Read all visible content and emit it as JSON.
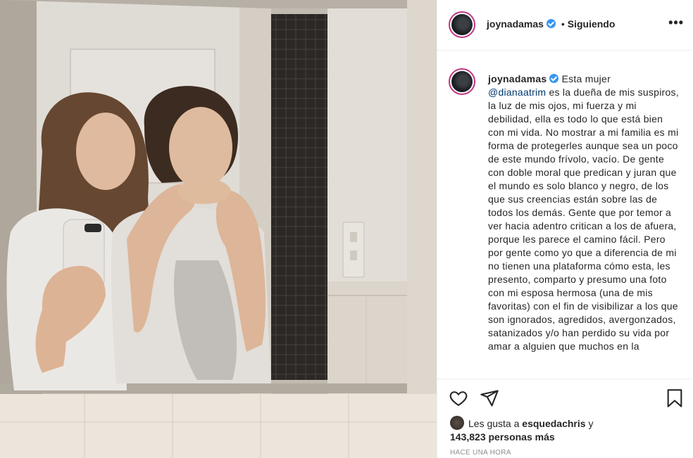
{
  "post": {
    "username": "joynadamas",
    "follow_status": "Siguiendo",
    "separator": "•",
    "more_label": "•••",
    "caption": {
      "username": "joynadamas",
      "intro": "Esta mujer",
      "mention": "@dianaatrim",
      "text": "es la dueña de mis suspiros, la luz de mis ojos, mi fuerza y mi debilidad, ella es todo lo que está bien con mi vida. No mostrar a mi familia es mi forma de protegerles aunque sea un poco de este mundo frívolo, vacío. De gente con doble moral que predican y juran que el mundo es solo blanco y negro, de los que sus creencias están sobre las de todos los demás. Gente que por temor a ver hacia adentro critican a los de afuera, porque les parece el camino fácil. Pero por gente como yo que a diferencia de mi no tienen una plataforma cómo esta, les presento, comparto y presumo una foto con mi esposa hermosa (una de mis favoritas) con el fin de visibilizar a los que son ignorados, agredidos, avergonzados, satanizados y/o han perdido su vida por amar a alguien que muchos en la"
    },
    "likes": {
      "prefix": "Les gusta a",
      "liker": "esquedachris",
      "conjunction": "y",
      "count": "143,823 personas más"
    },
    "timestamp": "HACE UNA HORA"
  },
  "icons": {
    "verified": "verified-badge-icon",
    "like": "heart-icon",
    "share": "paper-plane-icon",
    "save": "bookmark-icon",
    "more": "more-options-icon"
  },
  "colors": {
    "verified": "#3897f0",
    "mention": "#00376b",
    "muted": "#8e8e8e",
    "story_ring": "#c13584"
  }
}
